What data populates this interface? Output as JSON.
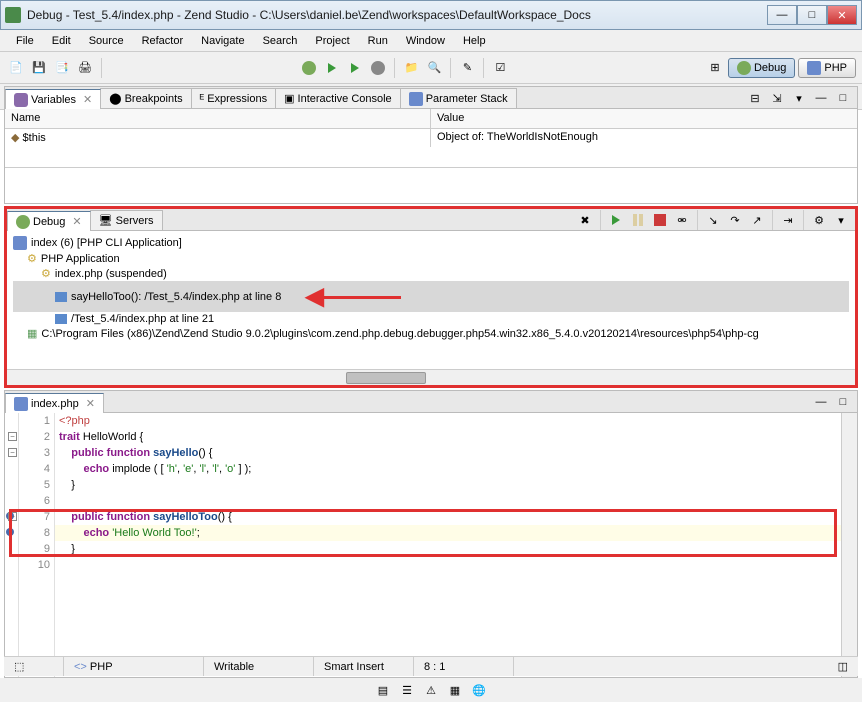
{
  "window": {
    "title": "Debug - Test_5.4/index.php - Zend Studio - C:\\Users\\daniel.be\\Zend\\workspaces\\DefaultWorkspace_Docs"
  },
  "menu": {
    "items": [
      "File",
      "Edit",
      "Source",
      "Refactor",
      "Navigate",
      "Search",
      "Project",
      "Run",
      "Window",
      "Help"
    ]
  },
  "perspectives": {
    "debug": "Debug",
    "php": "PHP"
  },
  "variables_view": {
    "tabs": {
      "variables": "Variables",
      "breakpoints": "Breakpoints",
      "expressions": "Expressions",
      "console": "Interactive Console",
      "paramstack": "Parameter Stack"
    },
    "columns": {
      "name": "Name",
      "value": "Value"
    },
    "rows": [
      {
        "name": "$this",
        "value": "Object of: TheWorldIsNotEnough"
      }
    ]
  },
  "debug_view": {
    "tabs": {
      "debug": "Debug",
      "servers": "Servers"
    },
    "tree": {
      "launch": "index (6) [PHP CLI Application]",
      "app": "PHP Application",
      "target": "index.php (suspended)",
      "frame1": "sayHelloToo(): /Test_5.4/index.php at line 8",
      "frame2": "/Test_5.4/index.php at line 21",
      "process": "C:\\Program Files (x86)\\Zend\\Zend Studio 9.0.2\\plugins\\com.zend.php.debug.debugger.php54.win32.x86_5.4.0.v20120214\\resources\\php54\\php-cg"
    }
  },
  "editor": {
    "filename": "index.php",
    "lines": [
      {
        "n": 1,
        "html": "<span class='tok-tag'>&lt;?php</span>"
      },
      {
        "n": 2,
        "html": "<span class='tok-kw'>trait</span> HelloWorld {"
      },
      {
        "n": 3,
        "html": "    <span class='tok-kw'>public function</span> <span class='tok-fn'>sayHello</span>() {"
      },
      {
        "n": 4,
        "html": "        <span class='tok-kw'>echo</span> implode ( [ <span class='tok-str'>'h'</span>, <span class='tok-str'>'e'</span>, <span class='tok-str'>'l'</span>, <span class='tok-str'>'l'</span>, <span class='tok-str'>'o'</span> ] );"
      },
      {
        "n": 5,
        "html": "    }"
      },
      {
        "n": 6,
        "html": ""
      },
      {
        "n": 7,
        "html": "    <span class='tok-kw'>public function</span> <span class='tok-fn'>sayHelloToo</span>() {"
      },
      {
        "n": 8,
        "html": "        <span class='tok-kw'>echo</span> <span class='tok-str'>'Hello World Too!'</span>;"
      },
      {
        "n": 9,
        "html": "    }"
      },
      {
        "n": 10,
        "html": ""
      }
    ],
    "current_line": 8,
    "highlight_start": 7,
    "highlight_end": 9
  },
  "status": {
    "lang": "PHP",
    "mode": "Writable",
    "insert": "Smart Insert",
    "pos": "8 : 1"
  }
}
